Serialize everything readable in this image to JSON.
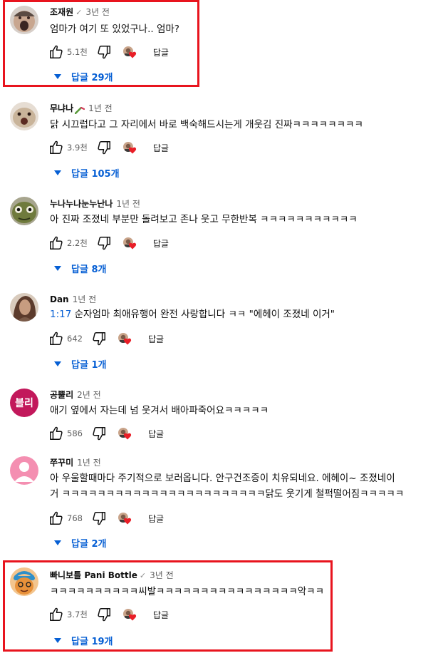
{
  "comments": [
    {
      "author": "조재원",
      "verified": true,
      "time": "3년 전",
      "timestamp_link": "",
      "text": "엄마가 여기 또 있었구나.. 엄마?",
      "text2": "",
      "likes": "5.1천",
      "reply_label": "답글",
      "replies": "답글 29개",
      "avatar_color": "#5a4a42"
    },
    {
      "author": "무냐나",
      "verified": false,
      "time": "1년 전",
      "timestamp_link": "",
      "text": "닭 시끄럽다고 그 자리에서 바로 백숙해드시는게 개웃김 진짜ㅋㅋㅋㅋㅋㅋㅋㅋ",
      "text2": "",
      "likes": "3.9천",
      "reply_label": "답글",
      "replies": "답글 105개",
      "avatar_color": "#c9b49a"
    },
    {
      "author": "누나누나눈누난나",
      "verified": false,
      "time": "1년 전",
      "timestamp_link": "",
      "text": "아 진짜 조졌네 부분만 돌려보고 존나 웃고 무한반복 ㅋㅋㅋㅋㅋㅋㅋㅋㅋㅋㅋ",
      "text2": "",
      "likes": "2.2천",
      "reply_label": "답글",
      "replies": "답글 8개",
      "avatar_color": "#6f7a3c"
    },
    {
      "author": "Dan",
      "verified": false,
      "time": "1년 전",
      "timestamp_link": "1:17",
      "text": " 순자엄마 최애유행어 완전 사랑합니다 ㅋㅋ \"에헤이 조졌네 이거\"",
      "text2": "",
      "likes": "642",
      "reply_label": "답글",
      "replies": "답글 1개",
      "avatar_color": "#7a5a48"
    },
    {
      "author": "공뿔리",
      "verified": false,
      "time": "2년 전",
      "timestamp_link": "",
      "text": "애기 옆에서 자는데 넘 웃겨서 배아파죽어요ㅋㅋㅋㅋㅋ",
      "text2": "",
      "likes": "586",
      "reply_label": "답글",
      "replies": "",
      "avatar_text": "블리",
      "avatar_color": "#c2185b"
    },
    {
      "author": "쭈꾸미",
      "verified": false,
      "time": "1년 전",
      "timestamp_link": "",
      "text": "아 우울할때마다 주기적으로 보러옵니다. 안구건조증이 치유되네요. 에헤이~ 조졌네이",
      "text2": "거 ㅋㅋㅋㅋㅋㅋㅋㅋㅋㅋㅋㅋㅋㅋㅋㅋㅋㅋㅋㅋㅋㅋㅋ닭도 웃기게 철퍽떨어짐ㅋㅋㅋㅋㅋ",
      "likes": "768",
      "reply_label": "답글",
      "replies": "답글 2개",
      "avatar_color": "#f48fb1"
    },
    {
      "author": "빠니보틀 Pani Bottle",
      "verified": true,
      "time": "3년 전",
      "timestamp_link": "",
      "text": "ㅋㅋㅋㅋㅋㅋㅋㅋㅋㅋ씨발ㅋㅋㅋㅋㅋㅋㅋㅋㅋㅋㅋㅋㅋㅋㅋㅋ악ㅋㅋ",
      "text2": "",
      "likes": "3.7천",
      "reply_label": "답글",
      "replies": "답글 19개",
      "avatar_color": "#e8913a"
    }
  ],
  "colors": {
    "link": "#065fd4",
    "highlight": "#e8141e",
    "heart": "#e91e27",
    "muted": "#606060"
  },
  "verified_glyph": "✓",
  "icons": [
    "thumb-up-icon",
    "thumb-down-icon",
    "creator-heart-icon",
    "caret-down-icon"
  ]
}
